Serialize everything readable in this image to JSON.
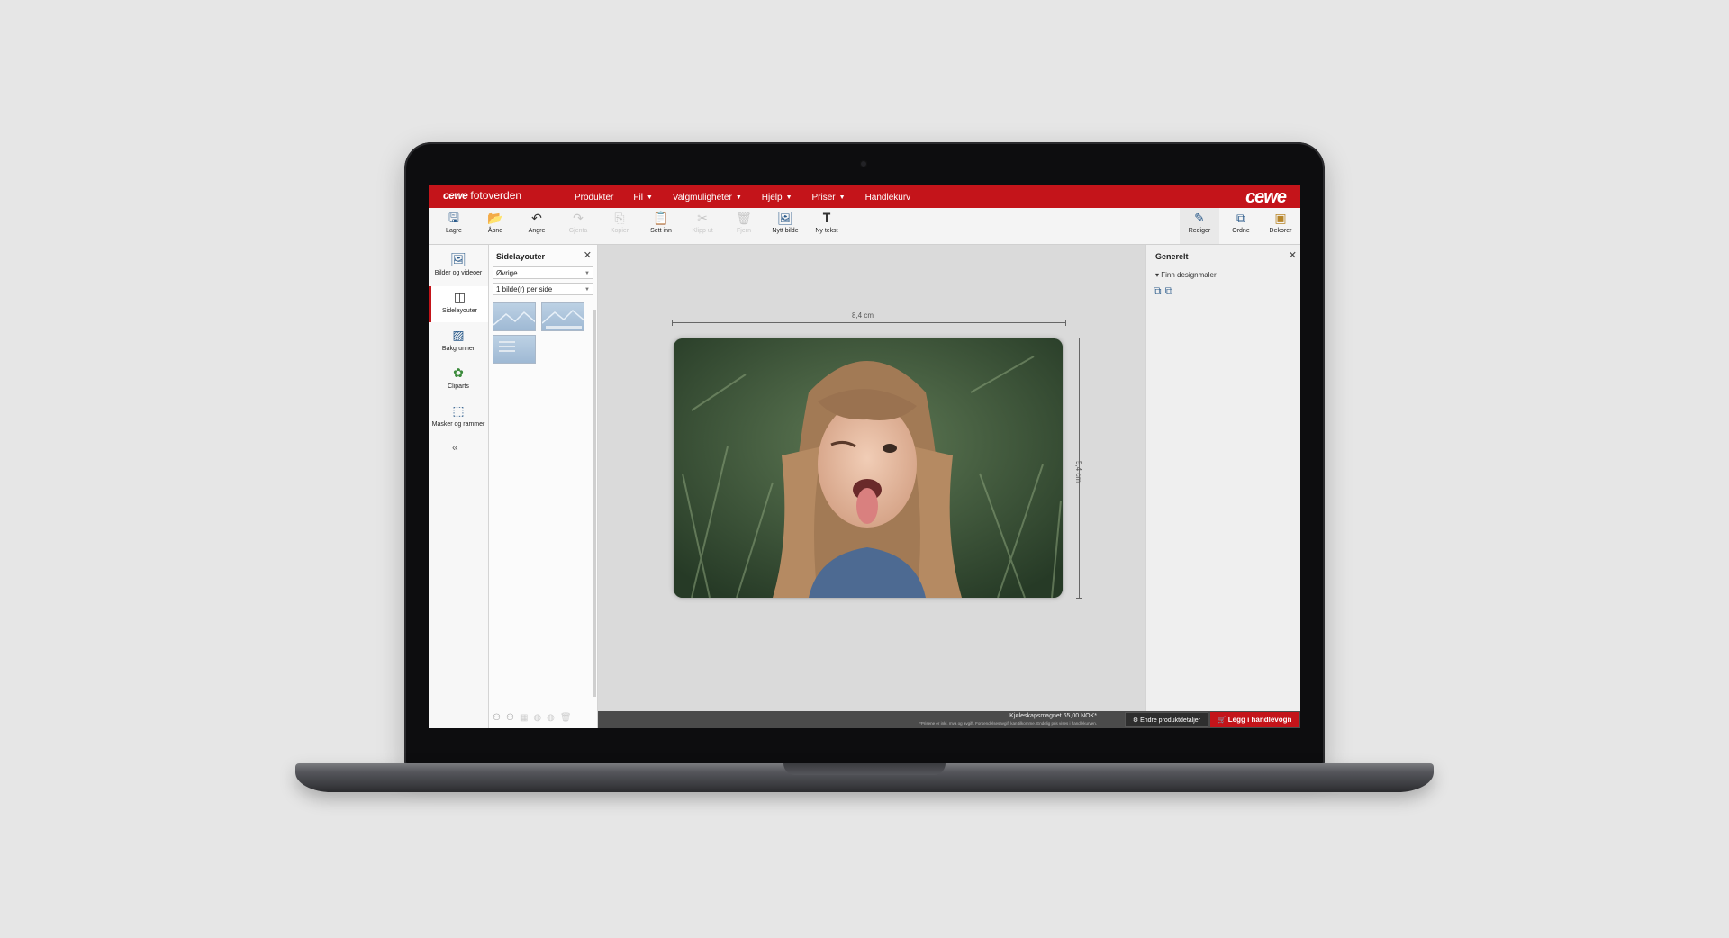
{
  "app": {
    "brand_logo_text": "cewe",
    "brand_name": "fotoverden",
    "logo_text": "cewe"
  },
  "menu": {
    "items": [
      {
        "label": "Produkter",
        "dropdown": false
      },
      {
        "label": "Fil",
        "dropdown": true
      },
      {
        "label": "Valgmuligheter",
        "dropdown": true
      },
      {
        "label": "Hjelp",
        "dropdown": true
      },
      {
        "label": "Priser",
        "dropdown": true
      },
      {
        "label": "Handlekurv",
        "dropdown": false
      }
    ]
  },
  "toolbar": {
    "lagre": "Lagre",
    "apne": "Åpne",
    "angre": "Angre",
    "gjenta": "Gjenta",
    "kopier": "Kopier",
    "sett_inn": "Sett inn",
    "klipp_ut": "Klipp ut",
    "fjern": "Fjern",
    "nytt_bilde": "Nytt bilde",
    "ny_tekst": "Ny tekst",
    "rediger": "Rediger",
    "ordne": "Ordne",
    "dekorer": "Dekorer"
  },
  "leftnav": {
    "items": [
      {
        "label": "Bilder og videoer",
        "icon": "image-icon"
      },
      {
        "label": "Sidelayouter",
        "icon": "layout-icon"
      },
      {
        "label": "Bakgrunner",
        "icon": "background-icon"
      },
      {
        "label": "Cliparts",
        "icon": "clipart-icon"
      },
      {
        "label": "Masker og rammer",
        "icon": "frame-icon"
      }
    ],
    "collapse_symbol": "«"
  },
  "panel": {
    "title": "Sidelayouter",
    "category_value": "Øvrige",
    "count_value": "1 bilde(r) per side"
  },
  "canvas": {
    "width_label": "8,4 cm",
    "height_label": "5,4 cm"
  },
  "rightpanel": {
    "title": "Generelt",
    "section_label": "Finn designmaler"
  },
  "status": {
    "price_text": "Kjøleskapsmagnet 65,00 NOK*",
    "note_text": "*Prisene er inkl. mva og avgift. Forsendelsesavgift kan tilkomme. Endelig pris vises i handlekurven.",
    "details_button": "Endre produktdetaljer",
    "cart_button": "Legg i handlevogn"
  },
  "colors": {
    "brand_red": "#c4141a",
    "accent_blue": "#2a7ad0",
    "status_bar": "#4b4b4b"
  }
}
